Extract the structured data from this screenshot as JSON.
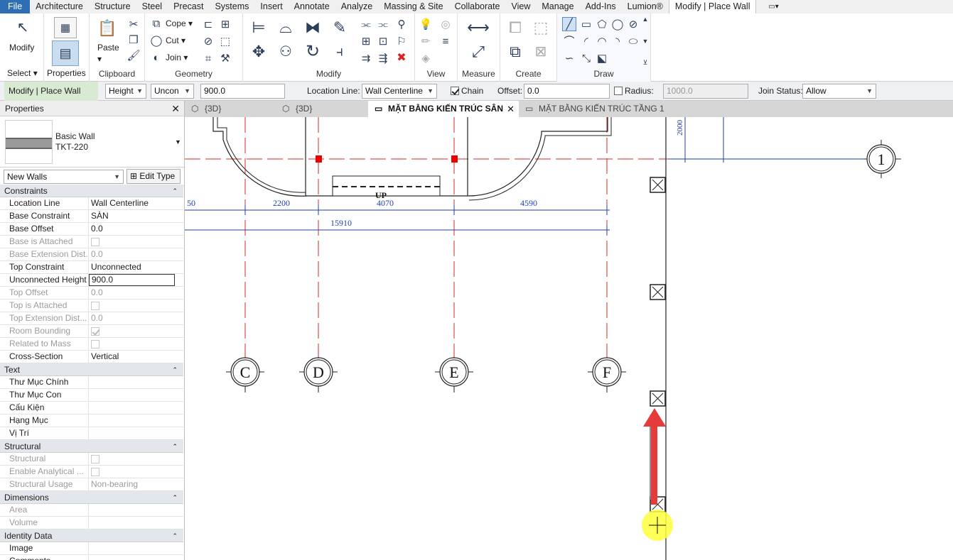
{
  "menu": {
    "file": "File",
    "tabs": [
      "Architecture",
      "Structure",
      "Steel",
      "Precast",
      "Systems",
      "Insert",
      "Annotate",
      "Analyze",
      "Massing & Site",
      "Collaborate",
      "View",
      "Manage",
      "Add-Ins",
      "Lumion®"
    ],
    "active": "Modify | Place Wall"
  },
  "ribbon": {
    "select": {
      "modify": "Modify",
      "select": "Select"
    },
    "properties": "Properties",
    "clipboard": {
      "paste": "Paste",
      "label": "Clipboard"
    },
    "geometry": {
      "cope": "Cope",
      "cut": "Cut",
      "join": "Join",
      "label": "Geometry"
    },
    "modify": "Modify",
    "view": "View",
    "measure": "Measure",
    "create": "Create",
    "draw": "Draw"
  },
  "options": {
    "context": "Modify | Place Wall",
    "height_mode": "Height",
    "top": "Uncon",
    "height_value": "900.0",
    "location_label": "Location Line:",
    "location_value": "Wall Centerline",
    "chain_label": "Chain",
    "chain_checked": true,
    "offset_label": "Offset:",
    "offset_value": "0.0",
    "radius_label": "Radius:",
    "radius_value": "1000.0",
    "join_label": "Join Status:",
    "join_value": "Allow"
  },
  "properties": {
    "title": "Properties",
    "family": "Basic Wall",
    "type": "TKT-220",
    "instance": "New Walls",
    "edit_type": "Edit Type",
    "groups": [
      {
        "name": "Constraints",
        "rows": [
          {
            "k": "Location Line",
            "v": "Wall Centerline"
          },
          {
            "k": "Base Constraint",
            "v": "SÀN"
          },
          {
            "k": "Base Offset",
            "v": "0.0"
          },
          {
            "k": "Base is Attached",
            "v": "",
            "disabled": true,
            "check": "off"
          },
          {
            "k": "Base Extension Dist...",
            "v": "0.0",
            "disabled": true
          },
          {
            "k": "Top Constraint",
            "v": "Unconnected"
          },
          {
            "k": "Unconnected Height",
            "v": "900.0",
            "editing": true
          },
          {
            "k": "Top Offset",
            "v": "0.0",
            "disabled": true
          },
          {
            "k": "Top is Attached",
            "v": "",
            "disabled": true,
            "check": "off"
          },
          {
            "k": "Top Extension Dist...",
            "v": "0.0",
            "disabled": true
          },
          {
            "k": "Room Bounding",
            "v": "",
            "disabled": true,
            "check": "on"
          },
          {
            "k": "Related to Mass",
            "v": "",
            "disabled": true,
            "check": "off"
          },
          {
            "k": "Cross-Section",
            "v": "Vertical"
          }
        ]
      },
      {
        "name": "Text",
        "rows": [
          {
            "k": "Thư Mục Chính",
            "v": ""
          },
          {
            "k": "Thư Mục Con",
            "v": ""
          },
          {
            "k": "Cấu Kiện",
            "v": ""
          },
          {
            "k": "Hạng Mục",
            "v": ""
          },
          {
            "k": "Vị Trí",
            "v": ""
          }
        ]
      },
      {
        "name": "Structural",
        "rows": [
          {
            "k": "Structural",
            "v": "",
            "disabled": true,
            "check": "off"
          },
          {
            "k": "Enable Analytical ...",
            "v": "",
            "disabled": true,
            "check": "off"
          },
          {
            "k": "Structural Usage",
            "v": "Non-bearing",
            "disabled": true
          }
        ]
      },
      {
        "name": "Dimensions",
        "rows": [
          {
            "k": "Area",
            "v": "",
            "disabled": true
          },
          {
            "k": "Volume",
            "v": "",
            "disabled": true
          }
        ]
      },
      {
        "name": "Identity Data",
        "rows": [
          {
            "k": "Image",
            "v": ""
          },
          {
            "k": "Comments",
            "v": ""
          }
        ]
      }
    ]
  },
  "view_tabs": [
    {
      "label": "{3D}",
      "active": false,
      "closable": false
    },
    {
      "label": "{3D}",
      "active": false,
      "closable": false
    },
    {
      "label": "MẶT BẰNG KIẾN TRÚC SÂN",
      "active": true,
      "closable": true
    },
    {
      "label": "MẶT BẰNG KIẾN TRÚC TẦNG 1",
      "active": false,
      "closable": false
    }
  ],
  "drawing": {
    "grids": [
      "C",
      "D",
      "E",
      "F",
      "1"
    ],
    "dims": [
      "50",
      "2200",
      "4070",
      "4590",
      "15910",
      "2000"
    ],
    "stair_label": "UP",
    "colors": {
      "grid": "#d42a2a",
      "dim": "#1f3fae",
      "line": "#222222",
      "highlight": "#ffff3c",
      "arrow": "#e53b3b"
    }
  }
}
